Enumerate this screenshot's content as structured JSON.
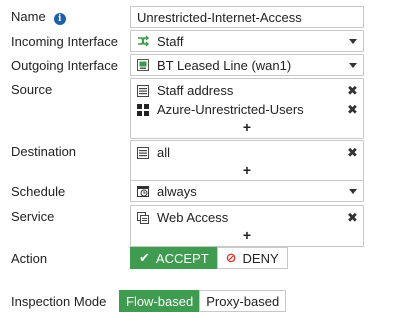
{
  "name": {
    "label": "Name",
    "value": "Unrestricted-Internet-Access"
  },
  "incoming_interface": {
    "label": "Incoming Interface",
    "value": "Staff",
    "icon": "network-switch-icon"
  },
  "outgoing_interface": {
    "label": "Outgoing Interface",
    "value": "BT Leased Line (wan1)",
    "icon": "wan-port-icon"
  },
  "source": {
    "label": "Source",
    "items": [
      {
        "text": "Staff address",
        "icon": "address-icon"
      },
      {
        "text": "Azure-Unrestricted-Users",
        "icon": "user-group-icon"
      }
    ],
    "add_label": "+"
  },
  "destination": {
    "label": "Destination",
    "items": [
      {
        "text": "all",
        "icon": "address-icon"
      }
    ],
    "add_label": "+"
  },
  "schedule": {
    "label": "Schedule",
    "value": "always",
    "icon": "schedule-clock-icon"
  },
  "service": {
    "label": "Service",
    "items": [
      {
        "text": "Web Access",
        "icon": "service-group-icon"
      }
    ],
    "add_label": "+"
  },
  "action": {
    "label": "Action",
    "options": [
      "ACCEPT",
      "DENY"
    ],
    "selected": "ACCEPT",
    "accept_glyph": "✔",
    "deny_glyph": "⊘"
  },
  "inspection_mode": {
    "label": "Inspection Mode",
    "options": [
      "Flow-based",
      "Proxy-based"
    ],
    "selected": "Flow-based"
  },
  "remove_glyph": "✖",
  "colors": {
    "accent_green": "#3e9b50",
    "deny_red": "#d9342b",
    "info_blue": "#1d5fa8",
    "interface_green": "#3a9a4a"
  }
}
